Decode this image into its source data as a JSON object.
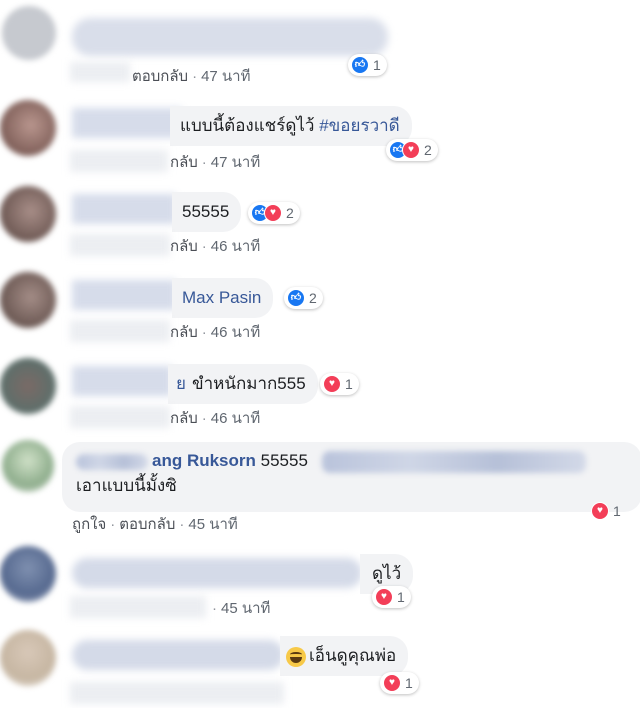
{
  "comments": [
    {
      "text": "",
      "reply": "ตอบกลับ",
      "time": "47 นาที",
      "reaction_count": "1",
      "reactions": [
        "like"
      ]
    },
    {
      "text": "แบบนี้ต้องแชร์ดูไว้ ",
      "hashtag": "#ขอยรวาดี",
      "reply": "กลับ",
      "time": "47 นาที",
      "reaction_count": "2",
      "reactions": [
        "like",
        "love"
      ]
    },
    {
      "text": "55555",
      "reply": "กลับ",
      "time": "46 นาที",
      "reaction_count": "2",
      "reactions": [
        "like",
        "love"
      ]
    },
    {
      "tag": "Max Pasin",
      "reply": "กลับ",
      "time": "46 นาที",
      "reaction_count": "2",
      "reactions": [
        "like"
      ]
    },
    {
      "name_tail": "ย",
      "text": "ขำหนักมาก555",
      "reply": "กลับ",
      "time": "46 นาที",
      "reaction_count": "1",
      "reactions": [
        "love"
      ]
    },
    {
      "name": "ang Ruksorn",
      "text": "55555",
      "text2": "เอาแบบนี้มั้งซิ",
      "like": "ถูกใจ",
      "reply": "ตอบกลับ",
      "time": "45 นาที",
      "reaction_count": "1",
      "reactions": [
        "love"
      ]
    },
    {
      "text": "ดูไว้",
      "time": "45 นาที",
      "reaction_count": "1",
      "reactions": [
        "love"
      ]
    },
    {
      "text": "เอ็นดูคุณพ่อ",
      "reaction_count": "1",
      "reactions": [
        "love"
      ]
    }
  ],
  "separator": "·",
  "colors": {
    "like": "#1877f2",
    "love": "#f33e58",
    "link": "#385898",
    "bubble": "#f2f3f5"
  }
}
